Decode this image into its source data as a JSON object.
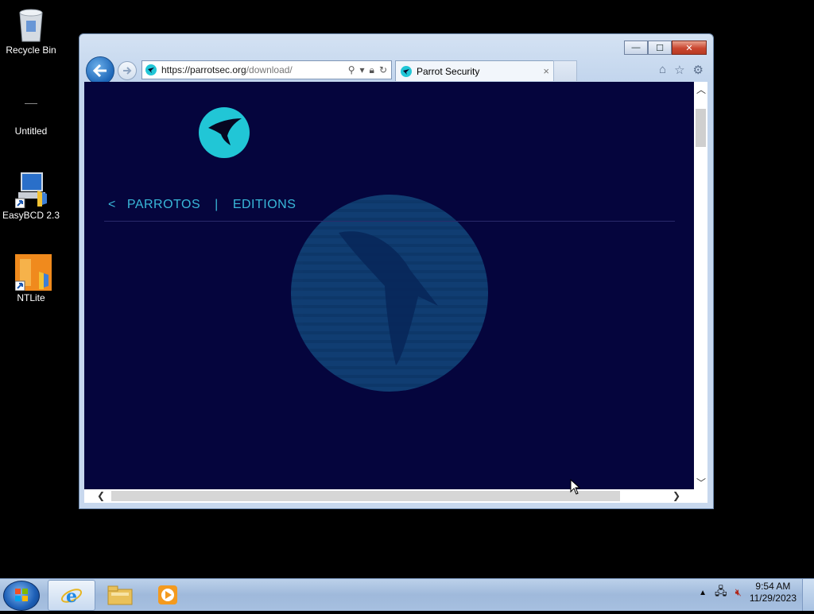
{
  "desktop": {
    "icons": [
      {
        "label": "Recycle Bin",
        "icon": "recycle-bin-icon"
      },
      {
        "label": "Untitled",
        "icon": "blank-file-icon"
      },
      {
        "label": "EasyBCD 2.3",
        "icon": "easybcd-icon"
      },
      {
        "label": "NTLite",
        "icon": "ntlite-icon"
      }
    ]
  },
  "browser": {
    "address": {
      "host": "https://parrotsec.org",
      "path": "/download/"
    },
    "tab": {
      "title": "Parrot Security",
      "close": "×"
    },
    "window_controls": {
      "minimize": "—",
      "maximize": "☐",
      "close": "✕"
    },
    "toolbar_icons": [
      "home-icon",
      "favorites-star-icon",
      "settings-gear-icon"
    ]
  },
  "page": {
    "nav": {
      "back_chevron": "<",
      "item1": "PARROTOS",
      "separator": "|",
      "item2": "EDITIONS"
    },
    "colors": {
      "background": "#05053d",
      "accent": "#39b8d9",
      "logo": "#21c6d6"
    }
  },
  "taskbar": {
    "pinned": [
      "internet-explorer-icon",
      "file-explorer-icon",
      "media-player-icon"
    ],
    "clock": {
      "time": "9:54 AM",
      "date": "11/29/2023"
    }
  }
}
